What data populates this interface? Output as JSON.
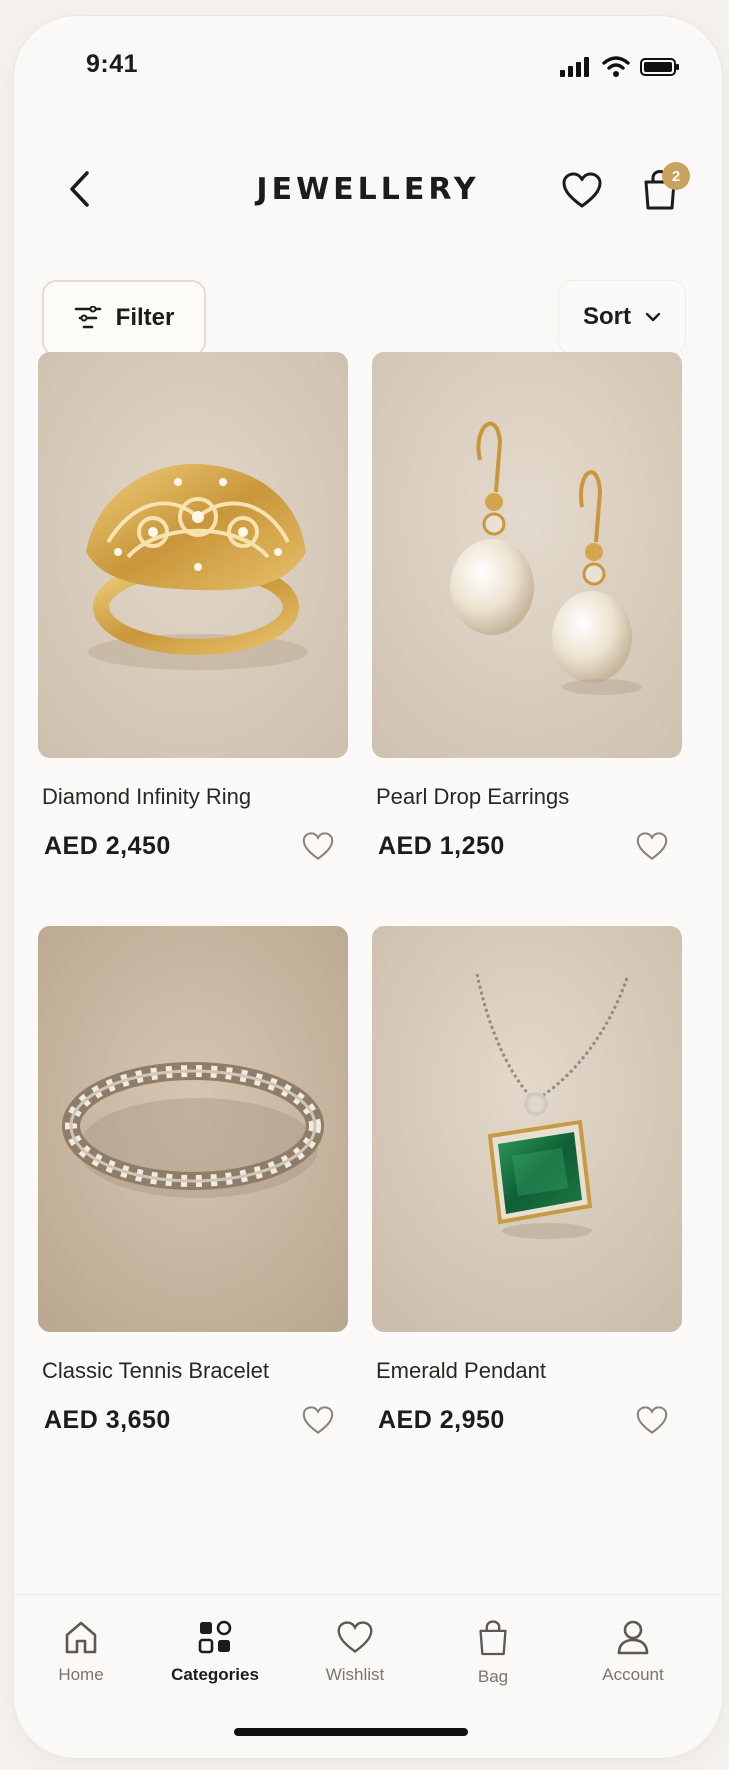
{
  "status_bar": {
    "time": "9:41"
  },
  "header": {
    "title": "JEWELLERY",
    "bag_count": "2"
  },
  "toolbar": {
    "filter_label": "Filter",
    "sort_label": "Sort"
  },
  "products": [
    {
      "name": "Diamond Infinity Ring",
      "price": "AED 2,450"
    },
    {
      "name": "Pearl Drop Earrings",
      "price": "AED 1,250"
    },
    {
      "name": "Classic Tennis Bracelet",
      "price": "AED 3,650"
    },
    {
      "name": "Emerald Pendant",
      "price": "AED 2,950"
    }
  ],
  "tabbar": {
    "items": [
      {
        "label": "Home",
        "icon": "home-icon"
      },
      {
        "label": "Categories",
        "icon": "categories-icon",
        "active": true
      },
      {
        "label": "Wishlist",
        "icon": "heart-icon"
      },
      {
        "label": "Bag",
        "icon": "bag-icon"
      },
      {
        "label": "Account",
        "icon": "account-icon"
      }
    ]
  },
  "colors": {
    "accent": "#c9a25e",
    "background": "#fbf9f7",
    "text": "#1e1c1a",
    "image_bg": "#d8cbbb"
  }
}
